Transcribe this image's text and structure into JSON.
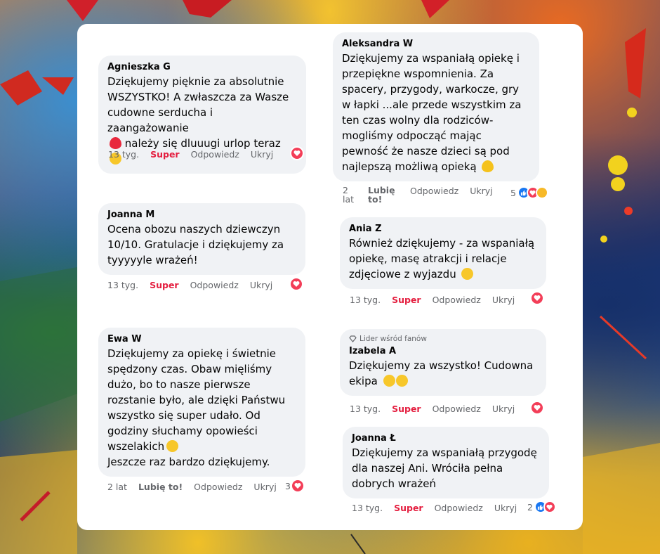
{
  "comments": [
    {
      "author": "Agnieszka G",
      "text": "Dziękujemy pięknie za absolutnie WSZYSTKO! A zwłaszcza za Wasze cudowne serducha i zaangażowanie",
      "text_end": "należy się dluuugi urlop teraz",
      "time": "13 tyg.",
      "reaction": "Super",
      "reply": "Odpowiedz",
      "hide": "Ukryj",
      "count": ""
    },
    {
      "author": "Joanna M",
      "text": "Ocena obozu naszych dziewczyn 10/10. Gratulacje i dziękujemy za tyyyyyle wrażeń!",
      "time": "13 tyg.",
      "reaction": "Super",
      "reply": "Odpowiedz",
      "hide": "Ukryj",
      "count": ""
    },
    {
      "author": "Ewa W",
      "text": "Dziękujemy za opiekę i świetnie spędzony czas. Obaw mięliśmy dużo, bo to nasze pierwsze rozstanie było, ale dzięki Państwu wszystko się super udało. Od godziny słuchamy opowieści wszelakich",
      "text_end": "Jeszcze raz bardzo dziękujemy.",
      "time": "2 lat",
      "reaction": "Lubię to!",
      "reply": "Odpowiedz",
      "hide": "Ukryj",
      "count": "3"
    },
    {
      "author": "Aleksandra W",
      "text": "Dziękujemy za wspaniałą opiekę i przepiękne wspomnienia. Za spacery, przygody, warkocze, gry w łapki ...ale przede wszystkim za ten czas wolny dla rodziców-mogliśmy odpocząć mając pewność że nasze dzieci są pod najlepszą możliwą opieką",
      "time": "2 lat",
      "reaction": "Lubię to!",
      "reply": "Odpowiedz",
      "hide": "Ukryj",
      "count": "5"
    },
    {
      "author": "Ania Z",
      "text": "Również dziękujemy - za wspaniałą opiekę, masę atrakcji i relacje zdjęciowe z wyjazdu",
      "time": "13 tyg.",
      "reaction": "Super",
      "reply": "Odpowiedz",
      "hide": "Ukryj",
      "count": ""
    },
    {
      "badge": "Lider wśród fanów",
      "author": "Izabela A",
      "text": "Dziękujemy za wszystko! Cudowna ekipa",
      "time": "13 tyg.",
      "reaction": "Super",
      "reply": "Odpowiedz",
      "hide": "Ukryj",
      "count": ""
    },
    {
      "author": "Joanna Ł",
      "text": "Dziękujemy za wspaniałą przygodę dla naszej Ani. Wróciła pełna dobrych wrażeń",
      "time": "13 tyg.",
      "reaction": "Super",
      "reply": "Odpowiedz",
      "hide": "Ukryj",
      "count": "2"
    }
  ],
  "colors": {
    "super": "#e41e3f",
    "bubble": "#f0f2f5",
    "meta": "#65676b",
    "heart": "#f33e58",
    "like": "#1877f2"
  }
}
